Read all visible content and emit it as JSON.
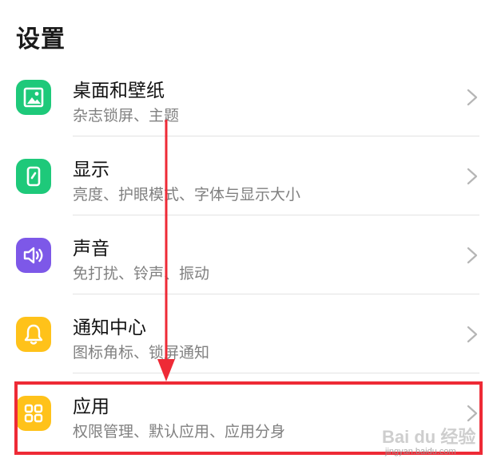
{
  "header": {
    "title": "设置"
  },
  "colors": {
    "green": "#1ec97a",
    "purple": "#7d58e8",
    "yellow": "#ffc21a",
    "highlight": "#ee2a36"
  },
  "items": [
    {
      "title": "桌面和壁纸",
      "subtitle": "杂志锁屏、主题",
      "icon": "image-icon",
      "color": "#1ec97a"
    },
    {
      "title": "显示",
      "subtitle": "亮度、护眼模式、字体与显示大小",
      "icon": "display-icon",
      "color": "#1ec97a"
    },
    {
      "title": "声音",
      "subtitle": "免打扰、铃声、振动",
      "icon": "speaker-icon",
      "color": "#7d58e8"
    },
    {
      "title": "通知中心",
      "subtitle": "图标角标、锁屏通知",
      "icon": "bell-icon",
      "color": "#ffc21a"
    },
    {
      "title": "应用",
      "subtitle": "权限管理、默认应用、应用分身",
      "icon": "apps-grid-icon",
      "color": "#ffc21a"
    }
  ],
  "watermark": {
    "logo": "Bai du 经验",
    "url": "jingyan.baidu.com"
  }
}
